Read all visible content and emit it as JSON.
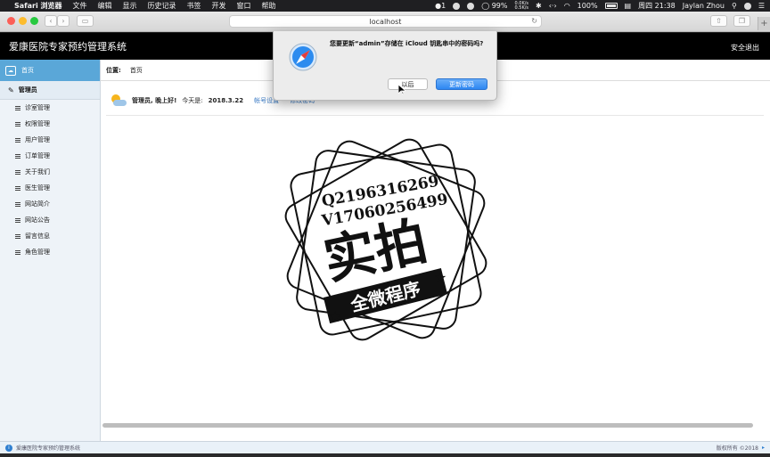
{
  "menubar": {
    "app": "Safari 浏览器",
    "items": [
      "文件",
      "编辑",
      "显示",
      "历史记录",
      "书签",
      "开发",
      "窗口",
      "帮助"
    ],
    "notification_count": "1",
    "net_up": "0.0K/s",
    "net_down": "0.5K/s",
    "cpu": "99%",
    "battery": "100%",
    "clock": "周四 21:38",
    "user": "Jaylan Zhou"
  },
  "browser": {
    "url": "localhost",
    "nav_back": "‹",
    "nav_forward": "›",
    "new_tab": "+"
  },
  "header": {
    "title": "爱康医院专家预约管理系统",
    "logout": "安全退出"
  },
  "sidebar": {
    "home": "首页",
    "group": "管理员",
    "items": [
      {
        "label": "诊室管理"
      },
      {
        "label": "权限管理"
      },
      {
        "label": "用户管理"
      },
      {
        "label": "订单管理"
      },
      {
        "label": "关于我们"
      },
      {
        "label": "医生管理"
      },
      {
        "label": "网站简介"
      },
      {
        "label": "网站公告"
      },
      {
        "label": "留言信息"
      },
      {
        "label": "角色管理"
      }
    ]
  },
  "breadcrumb": {
    "label": "位置:",
    "current": "首页"
  },
  "greeting": {
    "hello": "管理员, 晚上好!",
    "today_label": "今天是:",
    "date": "2018.3.22",
    "account_link": "帐号设置",
    "password_link": "修改密码"
  },
  "watermark": {
    "line1": "Q2196316269",
    "line2": "V17060256499",
    "big": "实拍",
    "band": "全微程序"
  },
  "dialog": {
    "message": "您要更新“admin”存储在 iCloud 钥匙串中的密码吗?",
    "later": "以后",
    "update": "更新密码"
  },
  "statusbar": {
    "title": "爱康医院专家预约管理系统",
    "copyright": "版权所有 ©2018"
  },
  "colors": {
    "sidebar_active": "#5aa7d8",
    "header_bg": "#000000",
    "primary_button": "#2d86f2",
    "link": "#3b7bc4"
  }
}
